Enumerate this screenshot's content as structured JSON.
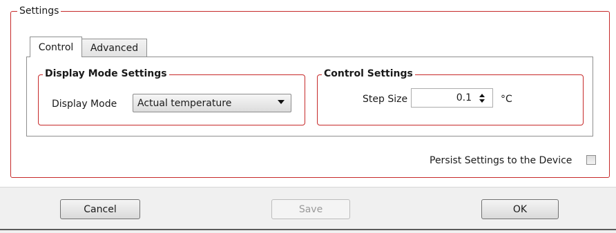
{
  "settings": {
    "title": "Settings"
  },
  "tabs": [
    {
      "label": "Control",
      "selected": true
    },
    {
      "label": "Advanced",
      "selected": false
    }
  ],
  "display_group": {
    "title": "Display Mode Settings",
    "display_mode_label": "Display Mode",
    "display_mode_value": "Actual temperature"
  },
  "control_group": {
    "title": "Control Settings",
    "step_size_label": "Step Size",
    "step_size_value": "0.1",
    "unit": "°C"
  },
  "persist": {
    "label": "Persist Settings to the Device",
    "checked": false
  },
  "buttons": {
    "cancel": "Cancel",
    "save": "Save",
    "ok": "OK"
  },
  "colors": {
    "group_border": "#c62828",
    "disabled_text": "#9a9a9a"
  }
}
